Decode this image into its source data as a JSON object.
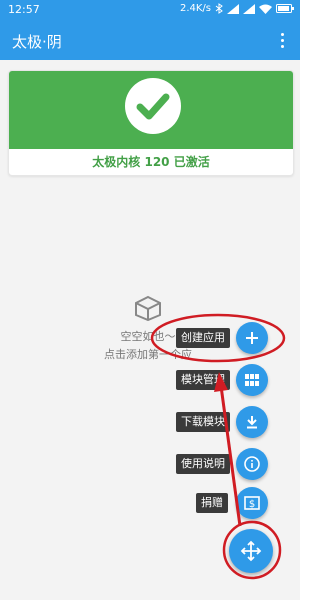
{
  "status_bar": {
    "time": "12:57",
    "network_speed": "2.4K/s"
  },
  "app_bar": {
    "title": "太极·阴"
  },
  "status_card": {
    "text": "太极内核 120 已激活",
    "color": "#4caf50"
  },
  "empty_state": {
    "line1": "空空如也～",
    "line2": "点击添加第一个应"
  },
  "fab_menu": {
    "items": [
      {
        "label": "创建应用",
        "icon": "plus-icon"
      },
      {
        "label": "模块管理",
        "icon": "grid-icon"
      },
      {
        "label": "下载模块",
        "icon": "download-icon"
      },
      {
        "label": "使用说明",
        "icon": "info-icon"
      },
      {
        "label": "捐赠",
        "icon": "donate-icon"
      }
    ],
    "main_icon": "move-arrows-icon"
  },
  "colors": {
    "accent": "#2f9ae8",
    "annotation": "#d01c23"
  }
}
